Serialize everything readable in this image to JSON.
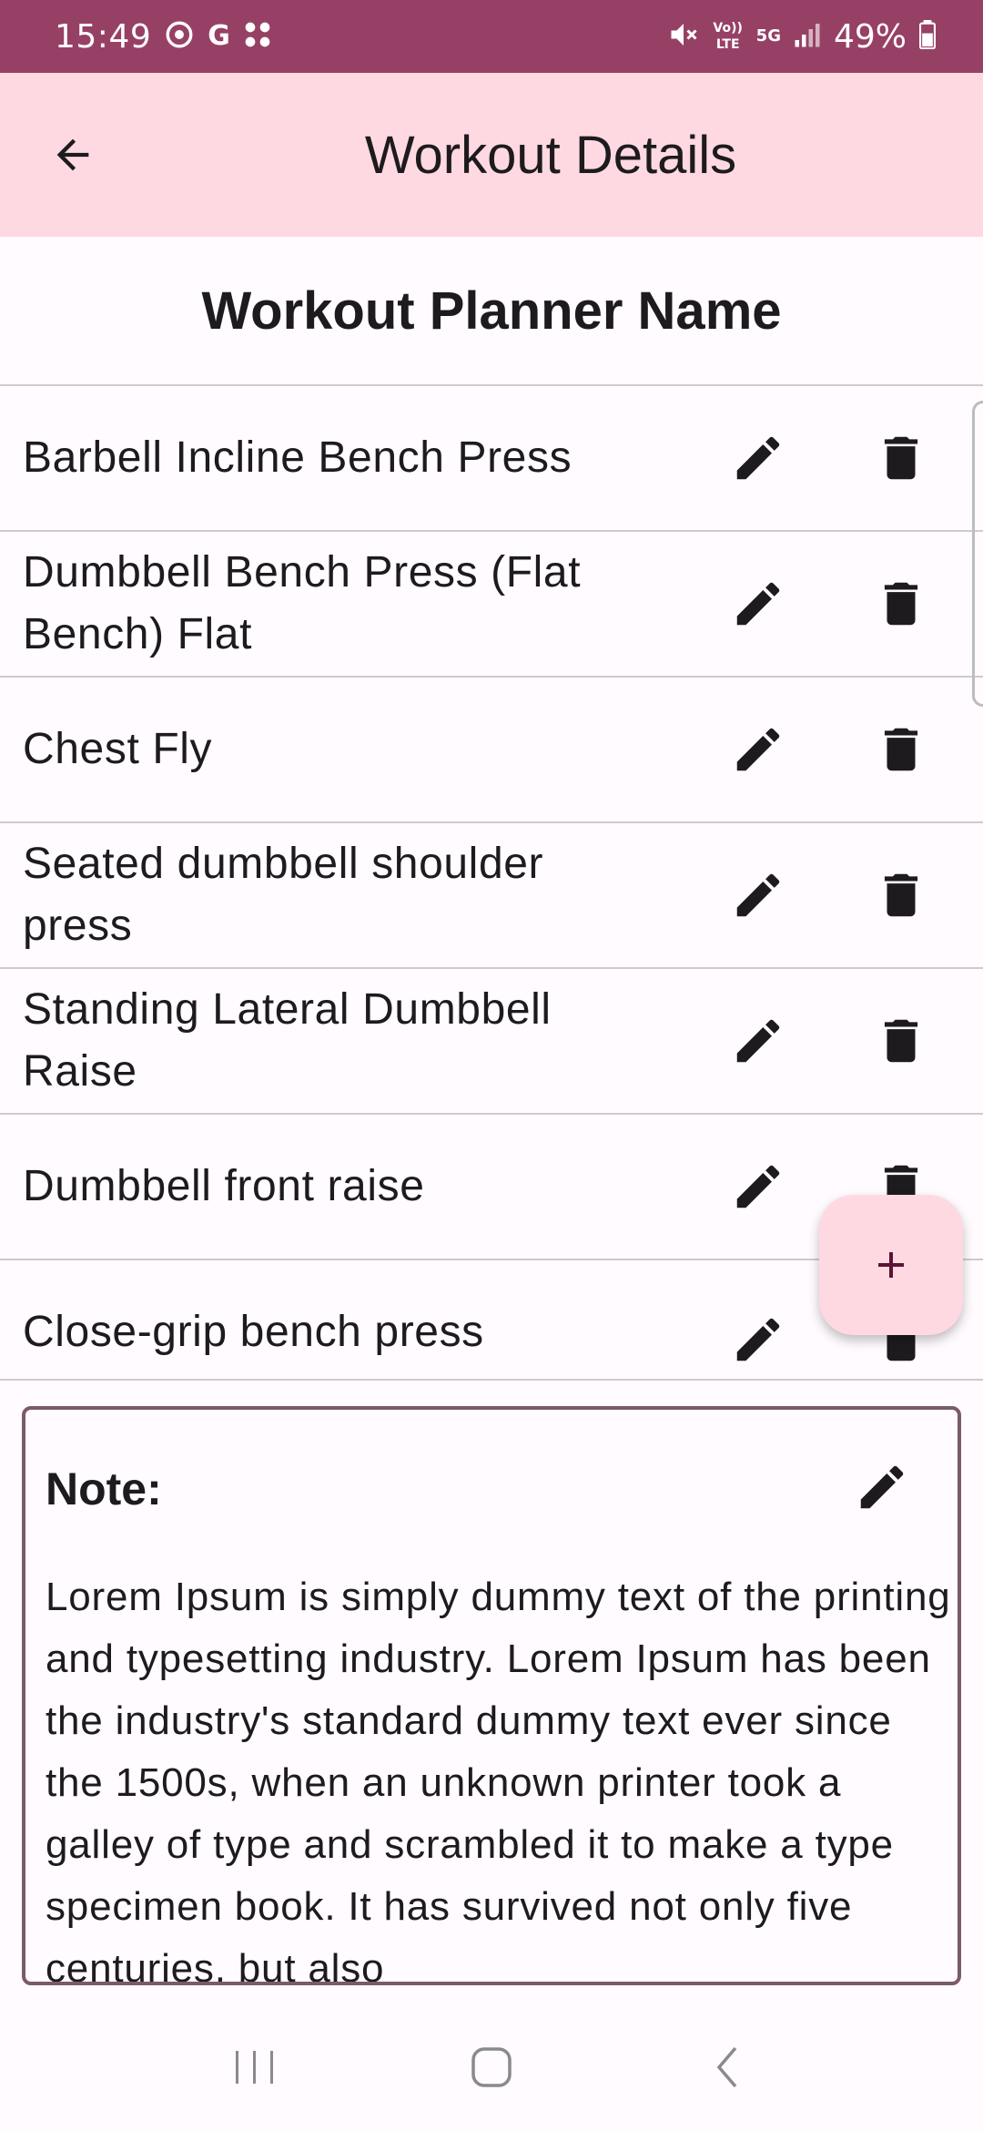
{
  "status_bar": {
    "time": "15:49",
    "left_icons": [
      "focus-icon",
      "google-icon",
      "app-grid-icon"
    ],
    "volte_label": "Vo)) LTE",
    "network_label": "5G",
    "battery": "49%"
  },
  "app_bar": {
    "title": "Workout Details",
    "background": "#ffd9e2"
  },
  "planner": {
    "name": "Workout Planner Name"
  },
  "exercises": [
    {
      "name": "Barbell Incline Bench Press"
    },
    {
      "name": "Dumbbell Bench Press (Flat Bench) Flat"
    },
    {
      "name": "Chest Fly"
    },
    {
      "name": "Seated dumbbell shoulder press"
    },
    {
      "name": "Standing Lateral Dumbbell Raise"
    },
    {
      "name": "Dumbbell front raise"
    },
    {
      "name": "Close-grip bench press"
    }
  ],
  "note": {
    "label": "Note:",
    "text": "Lorem Ipsum is simply dummy text of the printing and typesetting industry. Lorem Ipsum has been the industry's standard dummy text ever since the 1500s, when an unknown printer took a galley of type and scrambled it to make a type specimen book. It has survived not only five centuries, but also"
  },
  "fab": {
    "icon": "plus-icon"
  },
  "colors": {
    "status_bar": "#974065",
    "app_bar": "#ffd9e2",
    "fab": "#ffd9e2",
    "fab_icon": "#5c1436",
    "note_border": "#7a5b67"
  }
}
